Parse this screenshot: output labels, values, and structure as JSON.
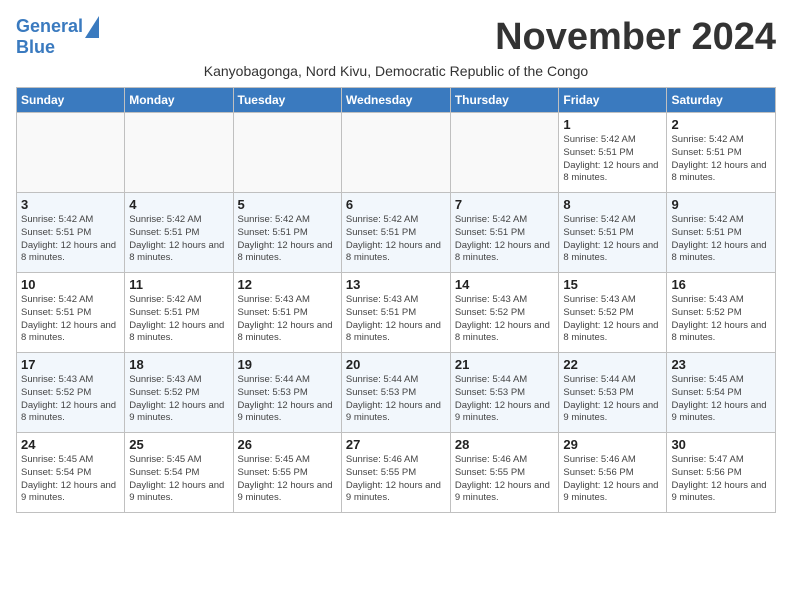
{
  "header": {
    "logo_line1": "General",
    "logo_line2": "Blue",
    "month_title": "November 2024",
    "subtitle": "Kanyobagonga, Nord Kivu, Democratic Republic of the Congo"
  },
  "weekdays": [
    "Sunday",
    "Monday",
    "Tuesday",
    "Wednesday",
    "Thursday",
    "Friday",
    "Saturday"
  ],
  "weeks": [
    [
      {
        "day": "",
        "info": ""
      },
      {
        "day": "",
        "info": ""
      },
      {
        "day": "",
        "info": ""
      },
      {
        "day": "",
        "info": ""
      },
      {
        "day": "",
        "info": ""
      },
      {
        "day": "1",
        "info": "Sunrise: 5:42 AM\nSunset: 5:51 PM\nDaylight: 12 hours and 8 minutes."
      },
      {
        "day": "2",
        "info": "Sunrise: 5:42 AM\nSunset: 5:51 PM\nDaylight: 12 hours and 8 minutes."
      }
    ],
    [
      {
        "day": "3",
        "info": "Sunrise: 5:42 AM\nSunset: 5:51 PM\nDaylight: 12 hours and 8 minutes."
      },
      {
        "day": "4",
        "info": "Sunrise: 5:42 AM\nSunset: 5:51 PM\nDaylight: 12 hours and 8 minutes."
      },
      {
        "day": "5",
        "info": "Sunrise: 5:42 AM\nSunset: 5:51 PM\nDaylight: 12 hours and 8 minutes."
      },
      {
        "day": "6",
        "info": "Sunrise: 5:42 AM\nSunset: 5:51 PM\nDaylight: 12 hours and 8 minutes."
      },
      {
        "day": "7",
        "info": "Sunrise: 5:42 AM\nSunset: 5:51 PM\nDaylight: 12 hours and 8 minutes."
      },
      {
        "day": "8",
        "info": "Sunrise: 5:42 AM\nSunset: 5:51 PM\nDaylight: 12 hours and 8 minutes."
      },
      {
        "day": "9",
        "info": "Sunrise: 5:42 AM\nSunset: 5:51 PM\nDaylight: 12 hours and 8 minutes."
      }
    ],
    [
      {
        "day": "10",
        "info": "Sunrise: 5:42 AM\nSunset: 5:51 PM\nDaylight: 12 hours and 8 minutes."
      },
      {
        "day": "11",
        "info": "Sunrise: 5:42 AM\nSunset: 5:51 PM\nDaylight: 12 hours and 8 minutes."
      },
      {
        "day": "12",
        "info": "Sunrise: 5:43 AM\nSunset: 5:51 PM\nDaylight: 12 hours and 8 minutes."
      },
      {
        "day": "13",
        "info": "Sunrise: 5:43 AM\nSunset: 5:51 PM\nDaylight: 12 hours and 8 minutes."
      },
      {
        "day": "14",
        "info": "Sunrise: 5:43 AM\nSunset: 5:52 PM\nDaylight: 12 hours and 8 minutes."
      },
      {
        "day": "15",
        "info": "Sunrise: 5:43 AM\nSunset: 5:52 PM\nDaylight: 12 hours and 8 minutes."
      },
      {
        "day": "16",
        "info": "Sunrise: 5:43 AM\nSunset: 5:52 PM\nDaylight: 12 hours and 8 minutes."
      }
    ],
    [
      {
        "day": "17",
        "info": "Sunrise: 5:43 AM\nSunset: 5:52 PM\nDaylight: 12 hours and 8 minutes."
      },
      {
        "day": "18",
        "info": "Sunrise: 5:43 AM\nSunset: 5:52 PM\nDaylight: 12 hours and 9 minutes."
      },
      {
        "day": "19",
        "info": "Sunrise: 5:44 AM\nSunset: 5:53 PM\nDaylight: 12 hours and 9 minutes."
      },
      {
        "day": "20",
        "info": "Sunrise: 5:44 AM\nSunset: 5:53 PM\nDaylight: 12 hours and 9 minutes."
      },
      {
        "day": "21",
        "info": "Sunrise: 5:44 AM\nSunset: 5:53 PM\nDaylight: 12 hours and 9 minutes."
      },
      {
        "day": "22",
        "info": "Sunrise: 5:44 AM\nSunset: 5:53 PM\nDaylight: 12 hours and 9 minutes."
      },
      {
        "day": "23",
        "info": "Sunrise: 5:45 AM\nSunset: 5:54 PM\nDaylight: 12 hours and 9 minutes."
      }
    ],
    [
      {
        "day": "24",
        "info": "Sunrise: 5:45 AM\nSunset: 5:54 PM\nDaylight: 12 hours and 9 minutes."
      },
      {
        "day": "25",
        "info": "Sunrise: 5:45 AM\nSunset: 5:54 PM\nDaylight: 12 hours and 9 minutes."
      },
      {
        "day": "26",
        "info": "Sunrise: 5:45 AM\nSunset: 5:55 PM\nDaylight: 12 hours and 9 minutes."
      },
      {
        "day": "27",
        "info": "Sunrise: 5:46 AM\nSunset: 5:55 PM\nDaylight: 12 hours and 9 minutes."
      },
      {
        "day": "28",
        "info": "Sunrise: 5:46 AM\nSunset: 5:55 PM\nDaylight: 12 hours and 9 minutes."
      },
      {
        "day": "29",
        "info": "Sunrise: 5:46 AM\nSunset: 5:56 PM\nDaylight: 12 hours and 9 minutes."
      },
      {
        "day": "30",
        "info": "Sunrise: 5:47 AM\nSunset: 5:56 PM\nDaylight: 12 hours and 9 minutes."
      }
    ]
  ]
}
